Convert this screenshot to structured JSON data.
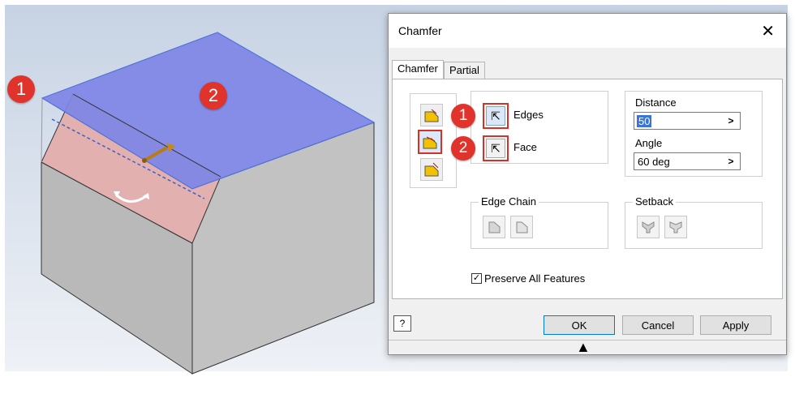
{
  "callouts": {
    "one": "1",
    "two": "2"
  },
  "dialog": {
    "title": "Chamfer",
    "close_glyph": "✕",
    "tabs": [
      {
        "label": "Chamfer"
      },
      {
        "label": "Partial"
      }
    ],
    "edges_label": "Edges",
    "face_label": "Face",
    "distance_label": "Distance",
    "distance_value": "50",
    "angle_label": "Angle",
    "angle_value": "60 deg",
    "edge_chain_label": "Edge Chain",
    "setback_label": "Setback",
    "preserve_label": "Preserve All Features",
    "preserve_checked": true,
    "ok_label": "OK",
    "cancel_label": "Cancel",
    "apply_label": "Apply",
    "help_glyph": "?",
    "expand_glyph": "▲"
  },
  "colors": {
    "viewport_bg_top": "#c7d3e4",
    "viewport_bg_bottom": "#f0f2f6",
    "selected_face": "#7e86e6",
    "chamfer_face": "#e3b0b0",
    "box_side": "#c8c8c8",
    "callout": "#e0332b"
  }
}
